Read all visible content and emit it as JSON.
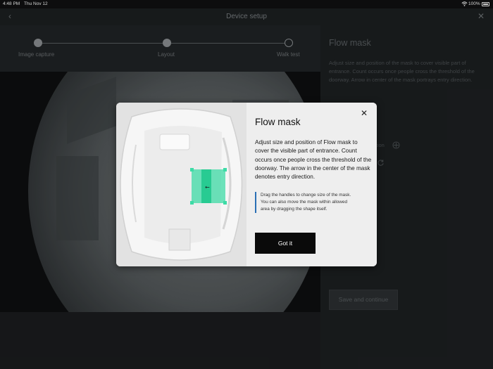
{
  "status_bar": {
    "time": "4:48 PM",
    "date": "Thu Nov 12",
    "battery": "100%"
  },
  "header": {
    "title": "Device setup",
    "back_icon": "‹",
    "close_icon": "✕"
  },
  "stepper": {
    "steps": [
      {
        "label": "Image capture",
        "state": "done"
      },
      {
        "label": "Layout",
        "state": "done"
      },
      {
        "label": "Walk test",
        "state": "pending"
      }
    ]
  },
  "side_panel": {
    "title": "Flow mask",
    "description": "Adjust size and position of the mask to cover visible part of entrance. Count occurs once people cross the threshold of the doorway. Arrow in center of the mask portrays entry direction.",
    "direction_label": "ction",
    "save_button": "Save and continue"
  },
  "modal": {
    "title": "Flow mask",
    "body": "Adjust size and position of Flow mask to cover the visible part of entrance. Count occurs once people cross the threshold of the doorway. The arrow in the center of the mask denotes entry direction.",
    "hint": "Drag the handles to change size of the mask. You can also move the mask within allowed area by dragging the shape itself.",
    "button": "Got it",
    "close_icon": "✕",
    "mask_arrow": "←",
    "mask_color": "#3ddba6"
  }
}
